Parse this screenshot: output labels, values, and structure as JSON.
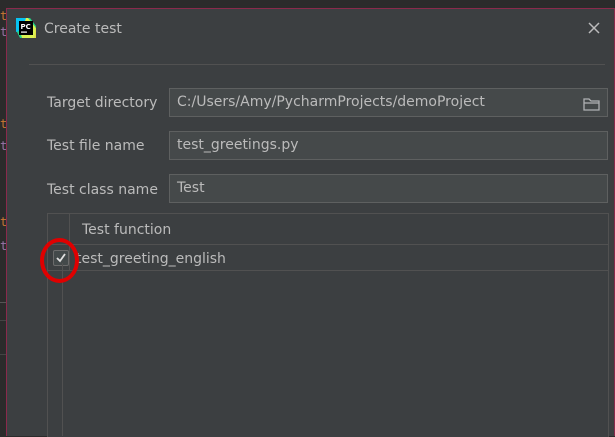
{
  "window": {
    "title": "Create test",
    "app_icon": "pycharm-icon",
    "app_icon_text": "PC",
    "close_icon": "close-icon"
  },
  "form": {
    "target_directory": {
      "label": "Target directory",
      "value": "C:/Users/Amy/PycharmProjects/demoProject",
      "button_icon": "folder-icon"
    },
    "test_file_name": {
      "label": "Test file name",
      "value": "test_greetings.py"
    },
    "test_class_name": {
      "label": "Test class name",
      "value": "Test"
    }
  },
  "functions_table": {
    "header": "Test function",
    "rows": [
      {
        "name": "test_greeting_english",
        "checked": true
      }
    ]
  },
  "editor_gutter_glyphs": [
    "t",
    "t",
    "t",
    "t",
    "t",
    "t"
  ],
  "colors": {
    "dialog_bg": "#3c3f41",
    "border_accent": "#8a2a4c",
    "annotation": "#e00000",
    "text": "#bbbbbb"
  }
}
